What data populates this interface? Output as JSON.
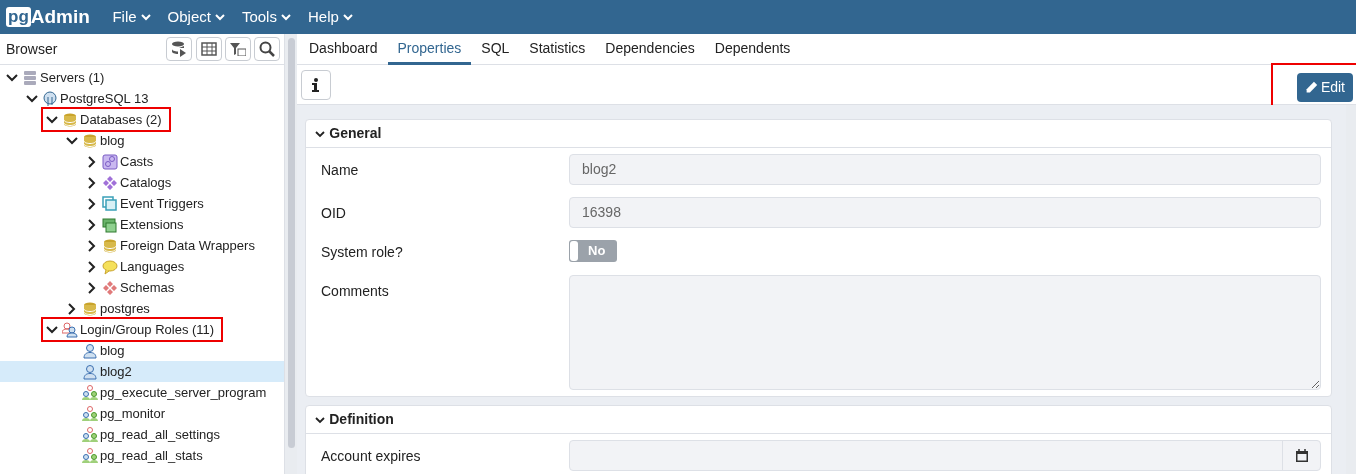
{
  "app": {
    "logo_prefix": "pg",
    "logo_suffix": "Admin",
    "menus": [
      "File",
      "Object",
      "Tools",
      "Help"
    ]
  },
  "browser": {
    "title": "Browser",
    "tree": [
      {
        "label": "Servers (1)",
        "kind": "servers",
        "expanded": true,
        "selected": false,
        "highlighted": false,
        "children": [
          {
            "label": "PostgreSQL 13",
            "kind": "server",
            "expanded": true,
            "selected": false,
            "highlighted": false,
            "children": [
              {
                "label": "Databases (2)",
                "kind": "database",
                "expanded": true,
                "selected": false,
                "highlighted": true,
                "children": [
                  {
                    "label": "blog",
                    "kind": "database",
                    "expanded": true,
                    "selected": false,
                    "highlighted": false,
                    "children": [
                      {
                        "label": "Casts",
                        "kind": "cast",
                        "expanded": false,
                        "selected": false,
                        "highlighted": false
                      },
                      {
                        "label": "Catalogs",
                        "kind": "catalog",
                        "expanded": false,
                        "selected": false,
                        "highlighted": false
                      },
                      {
                        "label": "Event Triggers",
                        "kind": "trigger",
                        "expanded": false,
                        "selected": false,
                        "highlighted": false
                      },
                      {
                        "label": "Extensions",
                        "kind": "extension",
                        "expanded": false,
                        "selected": false,
                        "highlighted": false
                      },
                      {
                        "label": "Foreign Data Wrappers",
                        "kind": "database",
                        "expanded": false,
                        "selected": false,
                        "highlighted": false
                      },
                      {
                        "label": "Languages",
                        "kind": "language",
                        "expanded": false,
                        "selected": false,
                        "highlighted": false
                      },
                      {
                        "label": "Schemas",
                        "kind": "schema",
                        "expanded": false,
                        "selected": false,
                        "highlighted": false
                      }
                    ]
                  },
                  {
                    "label": "postgres",
                    "kind": "database",
                    "expanded": false,
                    "selected": false,
                    "highlighted": false
                  }
                ]
              },
              {
                "label": "Login/Group Roles (11)",
                "kind": "roles",
                "expanded": true,
                "selected": false,
                "highlighted": true,
                "children": [
                  {
                    "label": "blog",
                    "kind": "user",
                    "selected": false,
                    "highlighted": false
                  },
                  {
                    "label": "blog2",
                    "kind": "user",
                    "selected": true,
                    "highlighted": false
                  },
                  {
                    "label": "pg_execute_server_program",
                    "kind": "group",
                    "selected": false,
                    "highlighted": false
                  },
                  {
                    "label": "pg_monitor",
                    "kind": "group",
                    "selected": false,
                    "highlighted": false
                  },
                  {
                    "label": "pg_read_all_settings",
                    "kind": "group",
                    "selected": false,
                    "highlighted": false
                  },
                  {
                    "label": "pg_read_all_stats",
                    "kind": "group",
                    "selected": false,
                    "highlighted": false
                  }
                ]
              }
            ]
          }
        ]
      }
    ]
  },
  "tabs": [
    {
      "label": "Dashboard",
      "selected": false
    },
    {
      "label": "Properties",
      "selected": true
    },
    {
      "label": "SQL",
      "selected": false
    },
    {
      "label": "Statistics",
      "selected": false
    },
    {
      "label": "Dependencies",
      "selected": false
    },
    {
      "label": "Dependents",
      "selected": false
    }
  ],
  "edit_button": {
    "label": "Edit",
    "highlighted": true
  },
  "sections": [
    {
      "title": "General",
      "expanded": true,
      "fields": [
        {
          "label": "Name",
          "kind": "text",
          "value": "blog2"
        },
        {
          "label": "OID",
          "kind": "text",
          "value": "16398"
        },
        {
          "label": "System role?",
          "kind": "switch",
          "on": false,
          "value": "No"
        },
        {
          "label": "Comments",
          "kind": "textarea"
        }
      ]
    },
    {
      "title": "Definition",
      "expanded": true,
      "fields": [
        {
          "label": "Account expires",
          "kind": "date"
        }
      ]
    }
  ]
}
